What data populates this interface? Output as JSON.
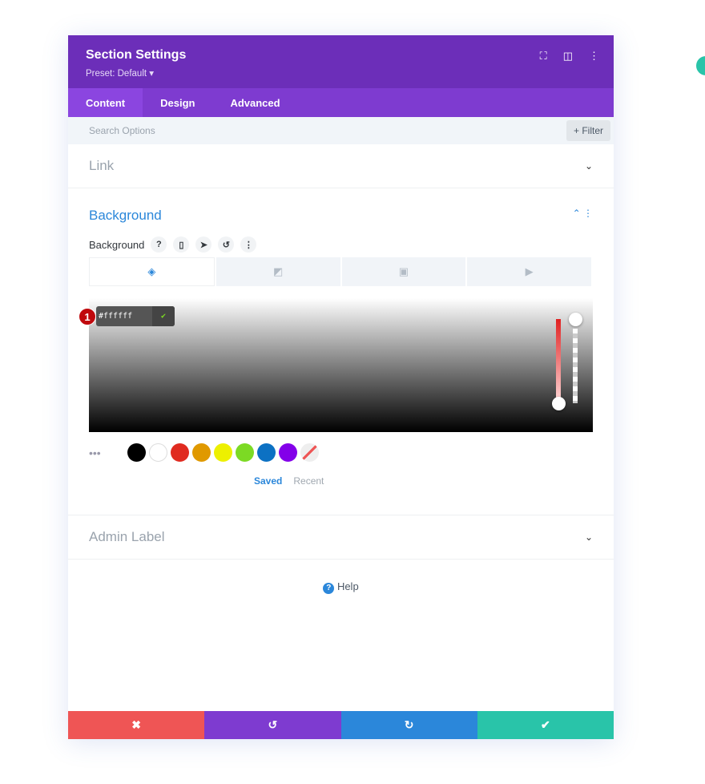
{
  "header": {
    "title": "Section Settings",
    "preset": "Preset: Default ▾"
  },
  "tabs": [
    {
      "label": "Content",
      "active": true
    },
    {
      "label": "Design"
    },
    {
      "label": "Advanced"
    }
  ],
  "search": {
    "placeholder": "Search Options",
    "filter": "+ Filter"
  },
  "sections": {
    "link": "Link",
    "background": "Background",
    "admin_label": "Admin Label"
  },
  "background": {
    "label": "Background",
    "hex": "#ffffff",
    "badge": "1",
    "swatches": [
      "#000000",
      "#ffffff",
      "#e02b20",
      "#e09900",
      "#edf000",
      "#7cda24",
      "#0c71c3",
      "#8300e9"
    ],
    "saved": "Saved",
    "recent": "Recent"
  },
  "help": "Help",
  "colors": {
    "header": "#6c2eb9",
    "tabs": "#7e3bd0",
    "accent": "#2b87da",
    "cancel": "#ef5555",
    "undo": "#7e3bd0",
    "redo": "#2b87da",
    "save": "#29c4a9"
  }
}
